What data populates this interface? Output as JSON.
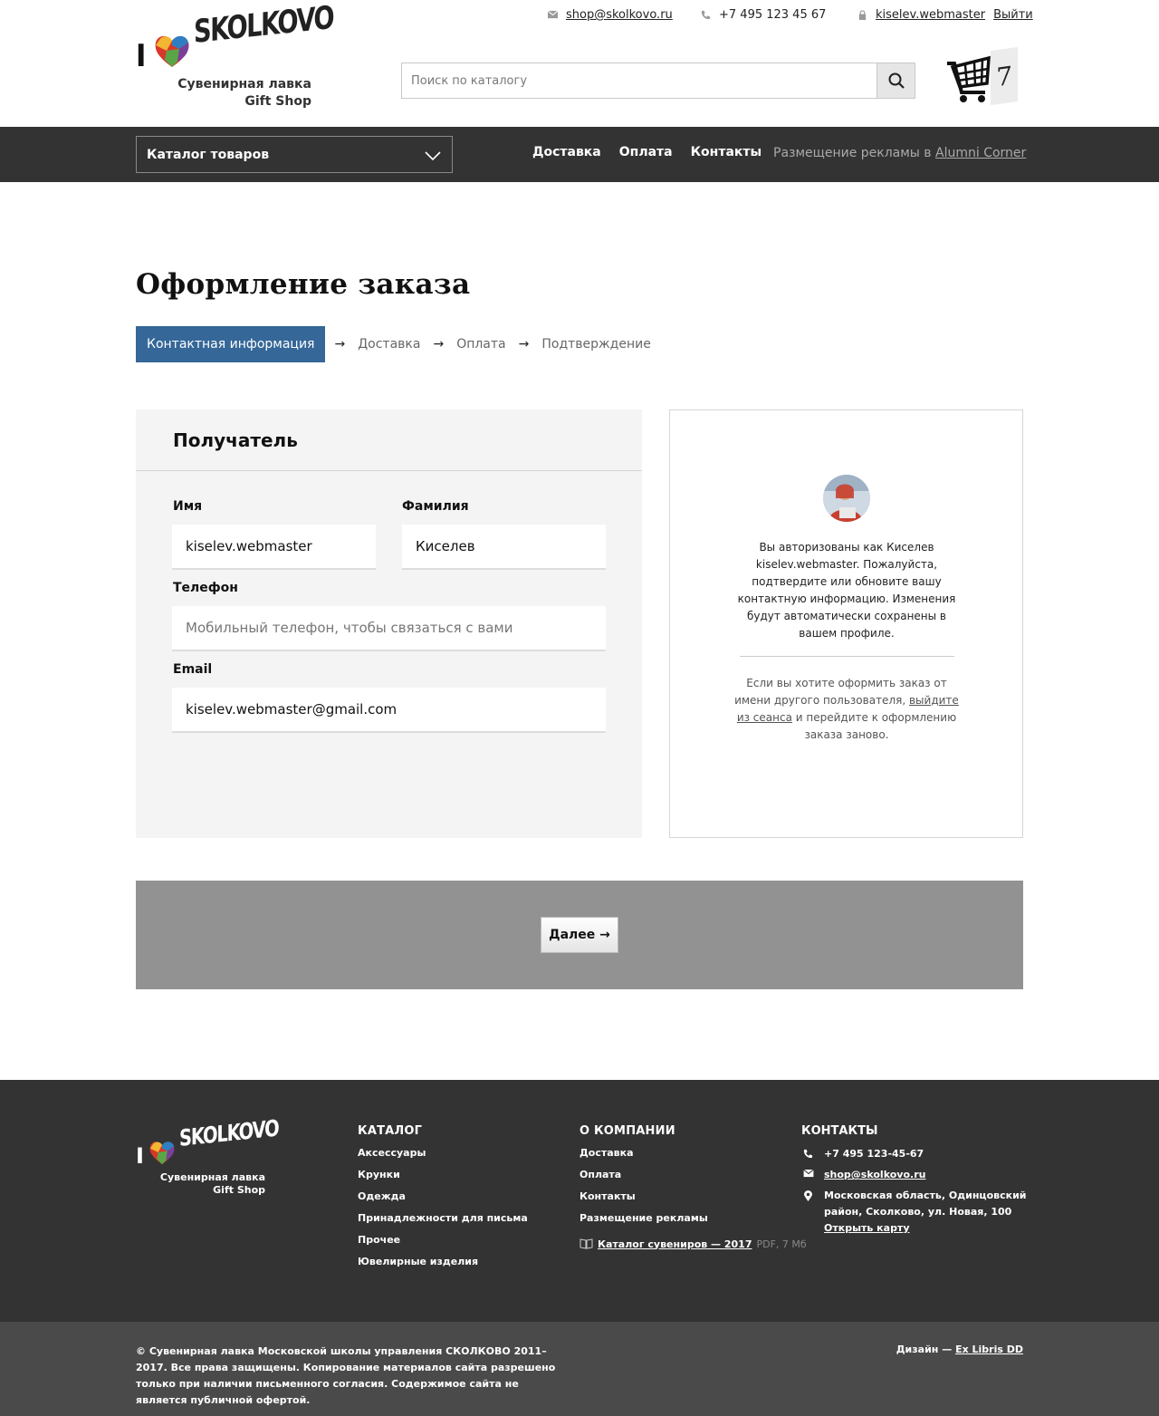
{
  "header": {
    "logo": {
      "i": "I",
      "word": "SKOLKOVO",
      "sub1": "Сувенирная лавка",
      "sub2": "Gift Shop"
    },
    "email": "shop@skolkovo.ru",
    "phone": "+7 495 123 45 67",
    "user": "kiselev.webmaster",
    "logout": "Выйти",
    "search_placeholder": "Поиск по каталогу",
    "cart_count": "7"
  },
  "nav": {
    "catalog": "Каталог товаров",
    "links": [
      "Доставка",
      "Оплата",
      "Контакты"
    ],
    "separator": "·",
    "ad_text": "Размещение рекламы в",
    "ad_link": "Alumni Corner"
  },
  "main": {
    "title": "Оформление заказа",
    "steps": [
      "Контактная информация",
      "Доставка",
      "Оплата",
      "Подтверждение"
    ],
    "arrow": "→",
    "form": {
      "heading": "Получатель",
      "first_name_label": "Имя",
      "first_name_value": "kiselev.webmaster",
      "last_name_label": "Фамилия",
      "last_name_value": "Киселев",
      "phone_label": "Телефон",
      "phone_placeholder": "Мобильный телефон, чтобы связаться с вами",
      "email_label": "Email",
      "email_value": "kiselev.webmaster@gmail.com"
    },
    "info": {
      "text": "Вы авторизованы как Киселев kiselev.webmaster. Пожалуйста, подтвердите или обновите вашу контактную информацию. Изменения будут автоматически сохранены в вашем профиле.",
      "text2_before": "Если вы хотите оформить заказ от имени другого пользователя,",
      "text2_link": "выйдите из сеанса",
      "text2_after": "и перейдите к оформлению заказа заново."
    },
    "next_button": "Далее →"
  },
  "footer": {
    "catalog": {
      "title": "Каталог",
      "items": [
        "Аксессуары",
        "Крунки",
        "Одежда",
        "Принадлежности для письма",
        "Прочее",
        "Ювелирные изделия"
      ]
    },
    "company": {
      "title": "О компании",
      "items": [
        "Доставка",
        "Оплата",
        "Контакты",
        "Размещение рекламы"
      ],
      "pdf_link": "Каталог сувениров — 2017",
      "pdf_meta": "PDF, 7 Мб"
    },
    "contacts": {
      "title": "КОНТАКТЫ",
      "phone": "+7 495 123-45-67",
      "email": "shop@skolkovo.ru",
      "address": "Московская область, Одинцовский район, Сколково, ул. Новая, 100",
      "map_link": "Открыть карту"
    },
    "copyright": "© Сувенирная лавка Московской школы управления СКОЛКОВО 2011–2017. Все права защищены. Копирование материалов сайта разрешено только при наличии письменного согласия. Содержимое сайта не является публичной офертой.",
    "design_label": "Дизайн —",
    "design_link": "Ex Libris DD"
  },
  "colors": {
    "accent": "#356798",
    "dark": "#333333",
    "subfooter": "#4a4a4a",
    "next_bar": "#929292"
  }
}
